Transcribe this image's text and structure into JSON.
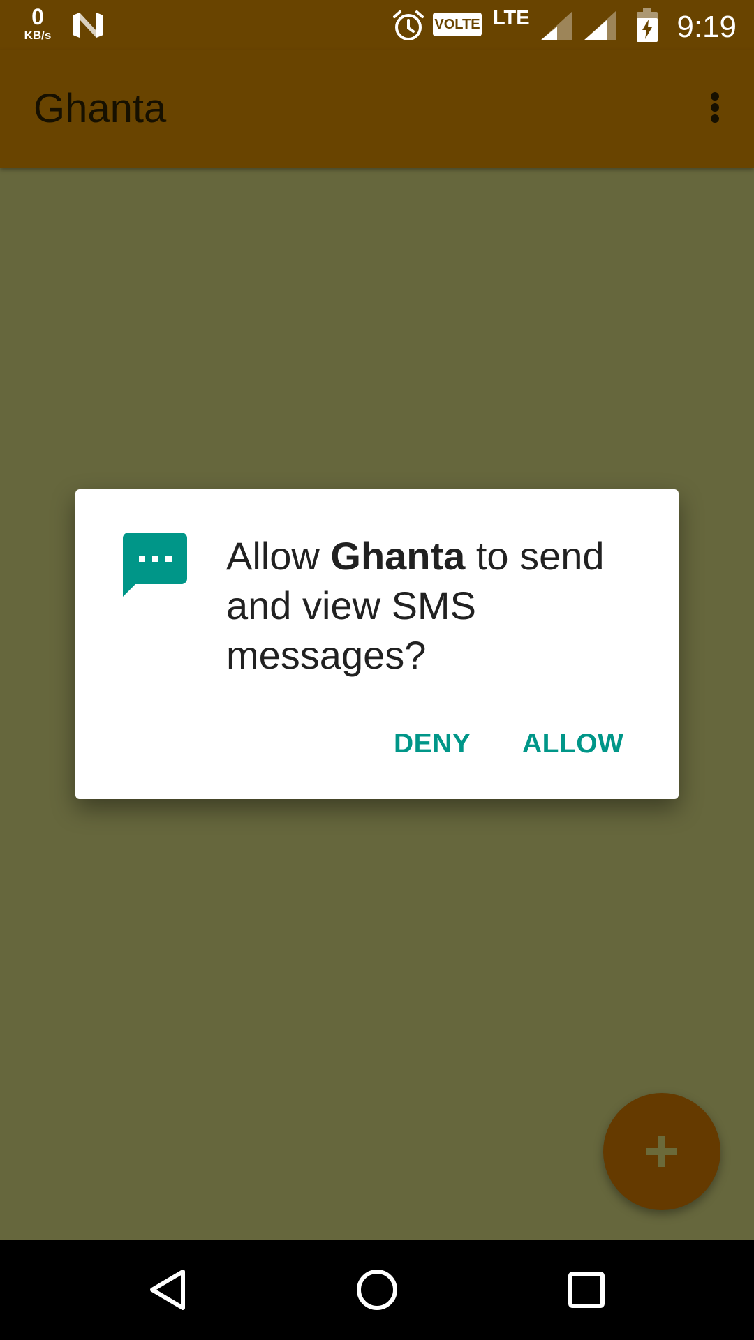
{
  "status_bar": {
    "network_speed_value": "0",
    "network_speed_unit": "KB/s",
    "volte_label": "VOLTE",
    "lte_label": "LTE",
    "time": "9:19",
    "icons": [
      "n-logo-icon",
      "alarm-icon",
      "signal-icon",
      "battery-charging-icon"
    ]
  },
  "app_bar": {
    "title": "Ghanta",
    "overflow_icon": "more-vert-icon"
  },
  "dialog": {
    "icon": "sms-message-icon",
    "message_prefix": "Allow ",
    "app_name": "Ghanta",
    "message_suffix": " to send and view SMS messages?",
    "deny_label": "DENY",
    "allow_label": "ALLOW"
  },
  "fab": {
    "icon": "plus-icon"
  },
  "nav_bar": {
    "icons": [
      "back-icon",
      "home-icon",
      "recents-icon"
    ]
  },
  "colors": {
    "status_bar": "#694400",
    "app_bar": "#694400",
    "scrim_background": "#66673d",
    "dialog_accent": "#009688",
    "fab": "#653a00",
    "nav_bar": "#000000"
  }
}
